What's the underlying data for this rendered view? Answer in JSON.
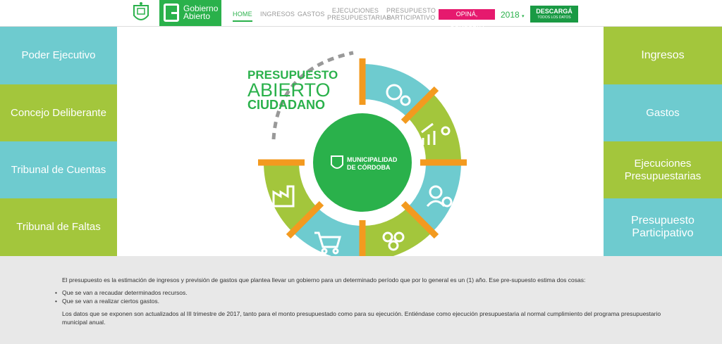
{
  "header": {
    "logo_line1": "Gobierno",
    "logo_line2": "Abierto",
    "nav": {
      "home": "HOME",
      "ingresos": "INGRESOS",
      "gastos": "GASTOS",
      "ejecuciones_l1": "EJECUCIONES",
      "ejecuciones_l2": "PRESUPUESTARIAS",
      "presupuesto_l1": "PRESUPUESTO",
      "presupuesto_l2": "PARTICIPATIVO"
    },
    "opina": "OPINÁ, CONSULTÁ",
    "year": "2018",
    "download_l1": "DESCARGÁ",
    "download_l2": "TODOS LOS DATOS"
  },
  "left_tiles": [
    "Poder Ejecutivo",
    "Concejo Deliberante",
    "Tribunal de Cuentas",
    "Tribunal de Faltas"
  ],
  "right_tiles": {
    "ingresos": "Ingresos",
    "gastos": "Gastos",
    "ejecuciones_l1": "Ejecuciones",
    "ejecuciones_l2": "Presupuestarias",
    "participativo_l1": "Presupuesto",
    "participativo_l2": "Participativo"
  },
  "hero": {
    "title_l1": "PRESUPUESTO",
    "title_l2": "ABIERTO",
    "title_l3": "CIUDADANO",
    "muni_l1": "MUNICIPALIDAD",
    "muni_l2": "DE CÓRDOBA"
  },
  "colors": {
    "green": "#2ab14b",
    "teal": "#6ecbcf",
    "lime": "#a3c63c",
    "orange": "#f39a1f",
    "pink": "#e6196e"
  },
  "info": {
    "intro": "El presupuesto es la estimación de ingresos y previsión de gastos que plantea llevar un gobierno para un determinado período que por lo general es un (1) año. Ese pre-supuesto estima dos cosas:",
    "bullet1": "Que se van a recaudar determinados recursos.",
    "bullet2": "Que se van a realizar ciertos gastos.",
    "note": "Los datos que se exponen son actualizados al III trimestre de 2017, tanto para el monto presupuestado como para su ejecución. Entiéndase como ejecución presupuestaria al normal cumplimiento del programa presupuestario municipal anual."
  }
}
